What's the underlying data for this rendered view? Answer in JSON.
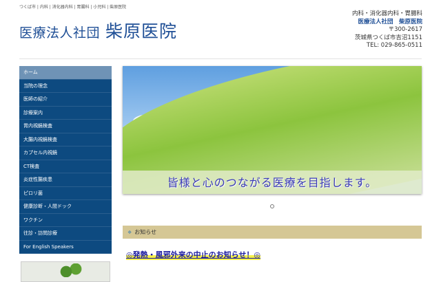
{
  "header": {
    "crumbs": "つくば市 | 内科 | 消化器内科 | 胃腸科 | 小児科 | 柴原医院",
    "logo_org": "医療法人社団",
    "logo_name": "柴原医院",
    "info": {
      "dept": "内科・消化器内科・胃腸科",
      "org": "医療法人社団　柴原医院",
      "zip": "〒300-2617",
      "address": "茨城県つくば市吉沼1151",
      "tel": "TEL: 029-865-0511"
    }
  },
  "nav": {
    "items": [
      "ホーム",
      "当院の理念",
      "医師の紹介",
      "診療案内",
      "胃内視鏡検査",
      "大腸内視鏡検査",
      "カプセル内視鏡",
      "CT検査",
      "炎症性腸疾患",
      "ピロリ菌",
      "健康診断・人間ドック",
      "ワクチン",
      "往診・訪問診療",
      "For English Speakers"
    ]
  },
  "banner": {
    "slogan": "皆様と心のつながる医療を目指します。"
  },
  "notice": {
    "title": "お知らせ",
    "icon": "diamond-icon",
    "headline": "◎発熱・風邪外来の中止のお知らせ！◎"
  }
}
